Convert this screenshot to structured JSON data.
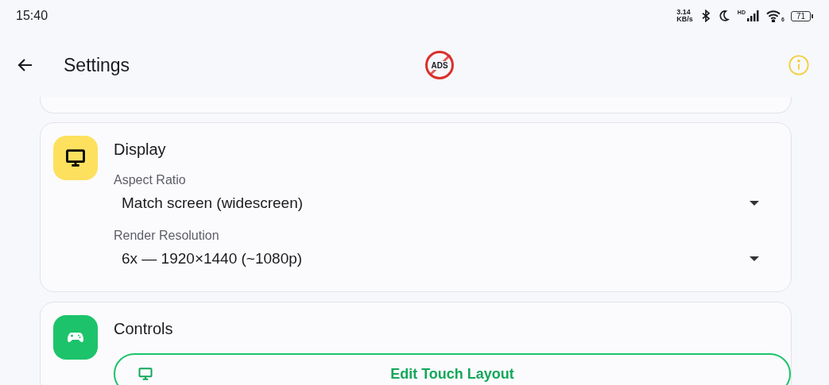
{
  "status_bar": {
    "time": "15:40",
    "speed": [
      "3.14",
      "KB/s"
    ],
    "signal_label": "HD",
    "wifi_label": "6",
    "battery": "71"
  },
  "toolbar": {
    "title": "Settings",
    "badge": "ADS"
  },
  "sections": [
    {
      "kind": "fields",
      "title": "Display",
      "color": "#fde05e",
      "fields": [
        {
          "label": "Aspect Ratio",
          "value": "Match screen (widescreen)"
        },
        {
          "label": "Render Resolution",
          "value": "6x — 1920×1440 (~1080p)"
        }
      ]
    },
    {
      "kind": "buttons",
      "title": "Controls",
      "color": "#1dc36a",
      "buttons": [
        {
          "label": "Edit Touch Layout"
        }
      ]
    }
  ]
}
